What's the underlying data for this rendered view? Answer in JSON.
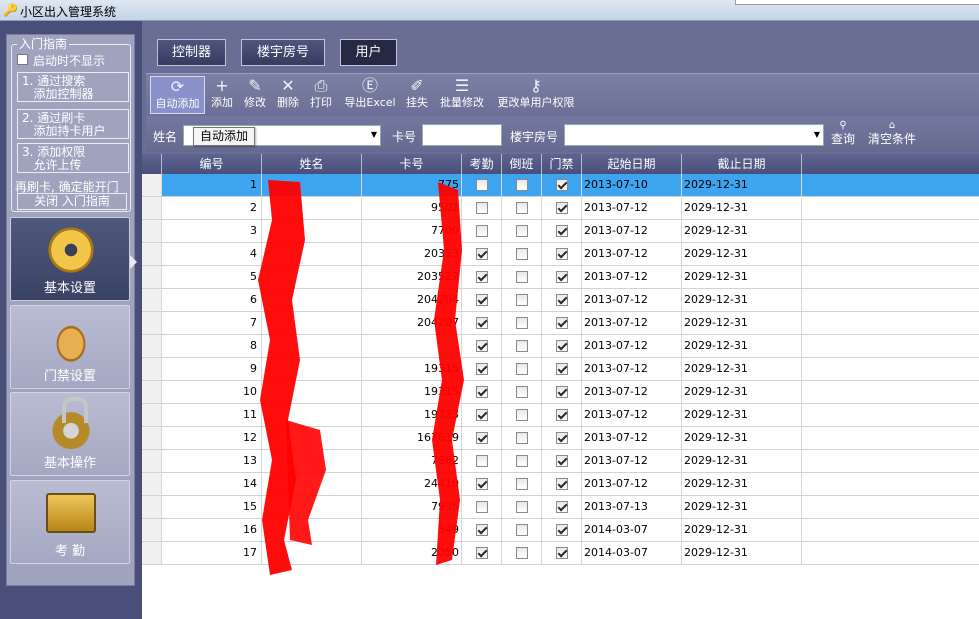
{
  "window": {
    "title": "小区出入管理系统",
    "icon": "key-icon"
  },
  "guide": {
    "legend": "入门指南",
    "startup_checkbox": "启动时不显示",
    "startup_checked": false,
    "steps": [
      "1. 通过搜索\n   添加控制器",
      "2. 通过刷卡\n   添加持卡用户",
      "3. 添加权限\n   允许上传"
    ],
    "tip": "再刷卡, 确定能开门",
    "close": "关闭 入门指南"
  },
  "nav": {
    "items": [
      {
        "label": "基本设置",
        "icon": "gear-icon",
        "active": true
      },
      {
        "label": "门禁设置",
        "icon": "lock-icon",
        "active": false
      },
      {
        "label": "基本操作",
        "icon": "hand-pointer-icon",
        "active": false
      },
      {
        "label": "考  勤",
        "icon": "id-card-icon",
        "active": false
      }
    ]
  },
  "top_tabs": {
    "controller": "控制器",
    "building": "楼宇房号",
    "user": "用户",
    "active": "用户"
  },
  "toolbar": {
    "auto_add": "自动添加",
    "add": "添加",
    "edit": "修改",
    "delete": "删除",
    "print": "打印",
    "export": "导出Excel",
    "lost": "挂失",
    "batch_edit": "批量修改",
    "perm": "更改单用户权限"
  },
  "filter": {
    "name_label": "姓名",
    "name_value": "",
    "card_label": "卡号",
    "card_value": "",
    "building_label": "楼宇房号",
    "building_value": "",
    "query": "查询",
    "clear": "清空条件",
    "tooltip": "自动添加"
  },
  "grid": {
    "columns": [
      "编号",
      "姓名",
      "卡号",
      "考勤",
      "倒班",
      "门禁",
      "起始日期",
      "截止日期"
    ],
    "rows": [
      {
        "no": "1",
        "name": "",
        "card": "775",
        "att": false,
        "shift": false,
        "door": true,
        "start": "2013-07-10",
        "end": "2029-12-31",
        "selected": true
      },
      {
        "no": "2",
        "name": "",
        "card": "9502",
        "att": false,
        "shift": false,
        "door": true,
        "start": "2013-07-12",
        "end": "2029-12-31",
        "selected": false
      },
      {
        "no": "3",
        "name": "",
        "card": "7709",
        "att": false,
        "shift": false,
        "door": true,
        "start": "2013-07-12",
        "end": "2029-12-31",
        "selected": false
      },
      {
        "no": "4",
        "name": "",
        "card": "20353",
        "att": true,
        "shift": false,
        "door": true,
        "start": "2013-07-12",
        "end": "2029-12-31",
        "selected": false
      },
      {
        "no": "5",
        "name": "",
        "card": "203527",
        "att": true,
        "shift": false,
        "door": true,
        "start": "2013-07-12",
        "end": "2029-12-31",
        "selected": false
      },
      {
        "no": "6",
        "name": "",
        "card": "204204",
        "att": true,
        "shift": false,
        "door": true,
        "start": "2013-07-12",
        "end": "2029-12-31",
        "selected": false
      },
      {
        "no": "7",
        "name": "",
        "card": "204207",
        "att": true,
        "shift": false,
        "door": true,
        "start": "2013-07-12",
        "end": "2029-12-31",
        "selected": false
      },
      {
        "no": "8",
        "name": "",
        "card": "",
        "att": true,
        "shift": false,
        "door": true,
        "start": "2013-07-12",
        "end": "2029-12-31",
        "selected": false
      },
      {
        "no": "9",
        "name": "",
        "card": "19315",
        "att": true,
        "shift": false,
        "door": true,
        "start": "2013-07-12",
        "end": "2029-12-31",
        "selected": false
      },
      {
        "no": "10",
        "name": "",
        "card": "19315",
        "att": true,
        "shift": false,
        "door": true,
        "start": "2013-07-12",
        "end": "2029-12-31",
        "selected": false
      },
      {
        "no": "11",
        "name": "",
        "card": "19323",
        "att": true,
        "shift": false,
        "door": true,
        "start": "2013-07-12",
        "end": "2029-12-31",
        "selected": false
      },
      {
        "no": "12",
        "name": "",
        "card": "167619",
        "att": true,
        "shift": false,
        "door": true,
        "start": "2013-07-12",
        "end": "2029-12-31",
        "selected": false
      },
      {
        "no": "13",
        "name": "",
        "card": "7862",
        "att": false,
        "shift": false,
        "door": true,
        "start": "2013-07-12",
        "end": "2029-12-31",
        "selected": false
      },
      {
        "no": "14",
        "name": "",
        "card": "24410",
        "att": true,
        "shift": false,
        "door": true,
        "start": "2013-07-12",
        "end": "2029-12-31",
        "selected": false
      },
      {
        "no": "15",
        "name": "",
        "card": "7935",
        "att": false,
        "shift": false,
        "door": true,
        "start": "2013-07-13",
        "end": "2029-12-31",
        "selected": false
      },
      {
        "no": "16",
        "name": "",
        "card": "549",
        "att": true,
        "shift": false,
        "door": true,
        "start": "2014-03-07",
        "end": "2029-12-31",
        "selected": false
      },
      {
        "no": "17",
        "name": "",
        "card": "2050",
        "att": true,
        "shift": false,
        "door": true,
        "start": "2014-03-07",
        "end": "2029-12-31",
        "selected": false
      }
    ]
  },
  "colors": {
    "selected_row": "#3da4f0",
    "panel": "#4a4f7a",
    "redaction": "#ff0000"
  }
}
